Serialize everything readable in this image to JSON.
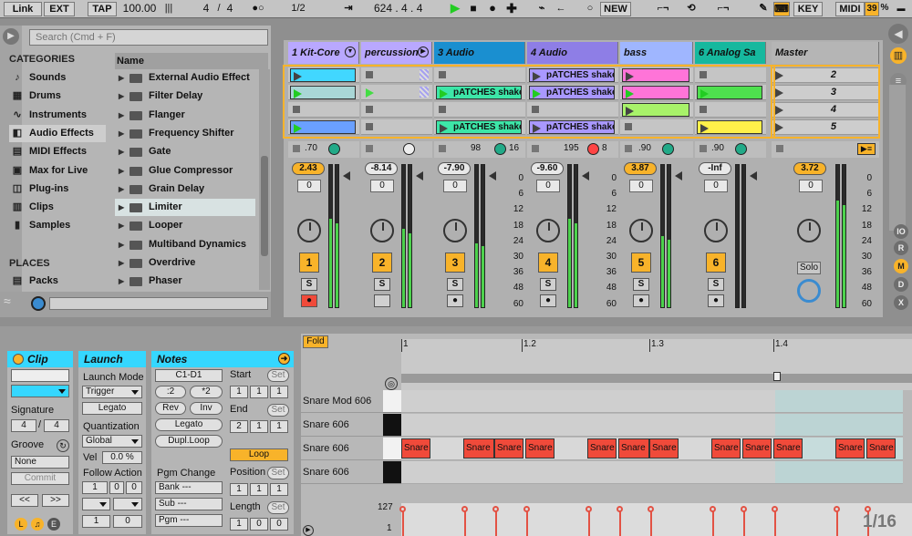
{
  "toolbar": {
    "link": "Link",
    "ext": "EXT",
    "tap": "TAP",
    "tempo": "100.00",
    "sig_num": "4",
    "sig_slash": "/",
    "sig_den": "4",
    "quant": "1/2",
    "position": "624 .   4 .   4",
    "new": "NEW",
    "key": "KEY",
    "midi": "MIDI",
    "cpu": "39",
    "cpu_unit": "%"
  },
  "browser": {
    "search_placeholder": "Search (Cmd + F)",
    "categories_title": "CATEGORIES",
    "categories": [
      "Sounds",
      "Drums",
      "Instruments",
      "Audio Effects",
      "MIDI Effects",
      "Max for Live",
      "Plug-ins",
      "Clips",
      "Samples"
    ],
    "places_title": "PLACES",
    "places": [
      "Packs"
    ],
    "list_header": "Name",
    "items": [
      "External Audio Effect",
      "Filter Delay",
      "Flanger",
      "Frequency Shifter",
      "Gate",
      "Glue Compressor",
      "Grain Delay",
      "Limiter",
      "Looper",
      "Multiband Dynamics",
      "Overdrive",
      "Phaser"
    ]
  },
  "tracks": [
    {
      "name": "1 Kit-Core",
      "color": "#b9a8ff",
      "vol": "2.43",
      "pan": "0",
      "num": "1",
      "sub": ".70",
      "clips": [
        {
          "color": "#41d7ff",
          "label": ""
        },
        {
          "color": "#a9d6d6",
          "label": ""
        },
        {
          "color": "",
          "label": ""
        },
        {
          "color": "#6aa0ff",
          "label": ""
        }
      ]
    },
    {
      "name": "percussion",
      "color": "#b9a8ff",
      "vol": "-8.14",
      "pan": "0",
      "num": "2",
      "sub": "",
      "clips": [
        {
          "color": "",
          "label": ""
        },
        {
          "color": "",
          "label": ""
        },
        {
          "color": "",
          "label": ""
        },
        {
          "color": "",
          "label": ""
        }
      ]
    },
    {
      "name": "3 Audio",
      "color": "#1a8fd0",
      "vol": "-7.90",
      "pan": "0",
      "num": "3",
      "sub": "98",
      "sub2": "16",
      "clips": [
        {
          "color": "",
          "label": ""
        },
        {
          "color": "#3de6a8",
          "label": "pATCHES shake"
        },
        {
          "color": "",
          "label": ""
        },
        {
          "color": "#3de6a8",
          "label": "pATCHES shake"
        }
      ]
    },
    {
      "name": "4 Audio",
      "color": "#8e7ee6",
      "vol": "-9.60",
      "pan": "0",
      "num": "4",
      "sub": "195",
      "sub2": "8",
      "clips": [
        {
          "color": "#a998ff",
          "label": "pATCHES shake"
        },
        {
          "color": "#a998ff",
          "label": "pATCHES shake"
        },
        {
          "color": "",
          "label": ""
        },
        {
          "color": "#a998ff",
          "label": "pATCHES shake"
        }
      ]
    },
    {
      "name": "bass",
      "color": "#9fb6ff",
      "vol": "3.87",
      "pan": "0",
      "num": "5",
      "sub": ".90",
      "clips": [
        {
          "color": "#ff74d8",
          "label": ""
        },
        {
          "color": "#ff74d8",
          "label": ""
        },
        {
          "color": "#a8f26a",
          "label": ""
        },
        {
          "color": "",
          "label": ""
        }
      ]
    },
    {
      "name": "6 Analog Sa",
      "color": "#16b89e",
      "vol": "-Inf",
      "pan": "0",
      "num": "6",
      "sub": ".90",
      "clips": [
        {
          "color": "",
          "label": ""
        },
        {
          "color": "#4ee04e",
          "label": ""
        },
        {
          "color": "",
          "label": ""
        },
        {
          "color": "#fff04a",
          "label": ""
        }
      ]
    }
  ],
  "master": {
    "name": "Master",
    "vol": "3.72",
    "pan": "0",
    "solo": "Solo",
    "scenes": [
      "2",
      "3",
      "4",
      "5"
    ]
  },
  "meter_scale": [
    "0",
    "6",
    "12",
    "18",
    "24",
    "30",
    "36",
    "48",
    "60"
  ],
  "meter_levels": [
    0.62,
    0.55,
    0.45,
    0.62,
    0.5,
    0.0,
    0.75
  ],
  "clip_view": {
    "title": "Clip",
    "signature_label": "Signature",
    "sig_num": "4",
    "sig_slash": "/",
    "sig_den": "4",
    "groove_label": "Groove",
    "groove_value": "None",
    "commit": "Commit",
    "prev": "<<",
    "next": ">>"
  },
  "launch": {
    "title": "Launch",
    "mode_label": "Launch Mode",
    "mode": "Trigger",
    "legato": "Legato",
    "quant_label": "Quantization",
    "quant": "Global",
    "vel": "Vel",
    "vel_value": "0.0 %",
    "follow_label": "Follow Action",
    "fa1": "1",
    "fa2": "0",
    "fa3": "0",
    "fa4": "1",
    "fa5": "0"
  },
  "notes": {
    "title": "Notes",
    "range": "C1-D1",
    "half": ":2",
    "double": "*2",
    "rev": "Rev",
    "inv": "Inv",
    "legato": "Legato",
    "dupl": "Dupl.Loop",
    "pgm_label": "Pgm Change",
    "bank": "Bank ---",
    "sub": "Sub ---",
    "pgm": "Pgm ---",
    "start_label": "Start",
    "set": "Set",
    "start": [
      "1",
      "1",
      "1"
    ],
    "end_label": "End",
    "end": [
      "2",
      "1",
      "1"
    ],
    "loop": "Loop",
    "position_label": "Position",
    "position": [
      "1",
      "1",
      "1"
    ],
    "length_label": "Length",
    "length": [
      "1",
      "0",
      "0"
    ]
  },
  "editor": {
    "fold": "Fold",
    "ruler": [
      "1",
      "1.2",
      "1.3",
      "1.4"
    ],
    "rows": [
      "Snare Mod 606",
      "Snare 606",
      "Snare 606",
      "Snare 606"
    ],
    "note_label": "Snare",
    "vel_max": "127",
    "vel_min": "1",
    "grid": "1/16"
  }
}
